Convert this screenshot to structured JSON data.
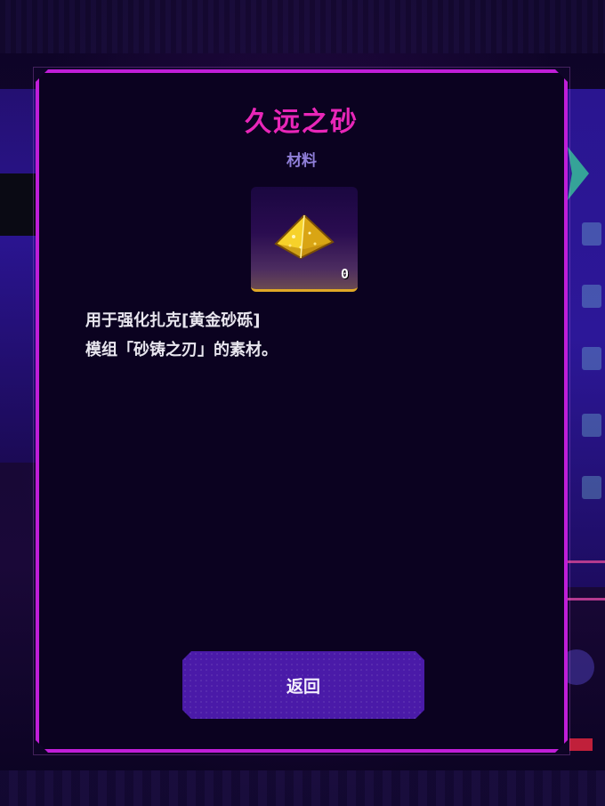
{
  "dialog": {
    "title": "久远之砂",
    "category": "材料",
    "item": {
      "icon": "golden-sand-pyramid-icon",
      "count": "0"
    },
    "description_lines": [
      "用于强化扎克[黄金砂砾]",
      "模组「砂铸之刃」的素材。"
    ],
    "back_button_label": "返回"
  },
  "colors": {
    "frame": "#c01ed8",
    "title": "#e826b8",
    "category": "#8f7ed8",
    "button": "#4a1aa8",
    "panel": "#0b0220"
  }
}
